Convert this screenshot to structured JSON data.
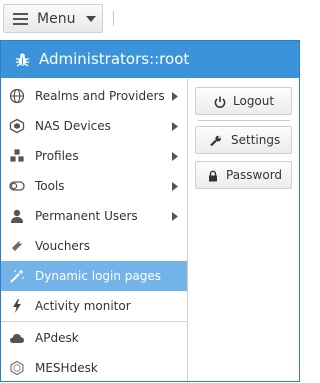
{
  "toolbar": {
    "menu_label": "Menu",
    "menu_icon": "hamburger-icon",
    "caret_icon": "caret-down-icon"
  },
  "panel": {
    "title": "Administrators::root",
    "title_icon": "bug-icon",
    "header_color": "#3b94d9",
    "active_color": "#74b3e7",
    "items": [
      {
        "label": "Realms and Providers",
        "icon": "globe-icon",
        "submenu": true
      },
      {
        "label": "NAS Devices",
        "icon": "nas-device-icon",
        "submenu": true
      },
      {
        "label": "Profiles",
        "icon": "cubes-icon",
        "submenu": true
      },
      {
        "label": "Tools",
        "icon": "toggle-icon",
        "submenu": true
      },
      {
        "label": "Permanent Users",
        "icon": "user-icon",
        "submenu": true
      },
      {
        "label": "Vouchers",
        "icon": "ticket-icon",
        "submenu": false
      },
      {
        "label": "Dynamic login pages",
        "icon": "magic-wand-icon",
        "submenu": false,
        "active": true
      },
      {
        "label": "Activity monitor",
        "icon": "lightning-icon",
        "submenu": false
      },
      {
        "label": "APdesk",
        "icon": "cloud-icon",
        "submenu": false
      },
      {
        "label": "MESHdesk",
        "icon": "hexagon-icon",
        "submenu": false
      }
    ]
  },
  "actions": {
    "logout": "Logout",
    "settings": "Settings",
    "password": "Password"
  }
}
